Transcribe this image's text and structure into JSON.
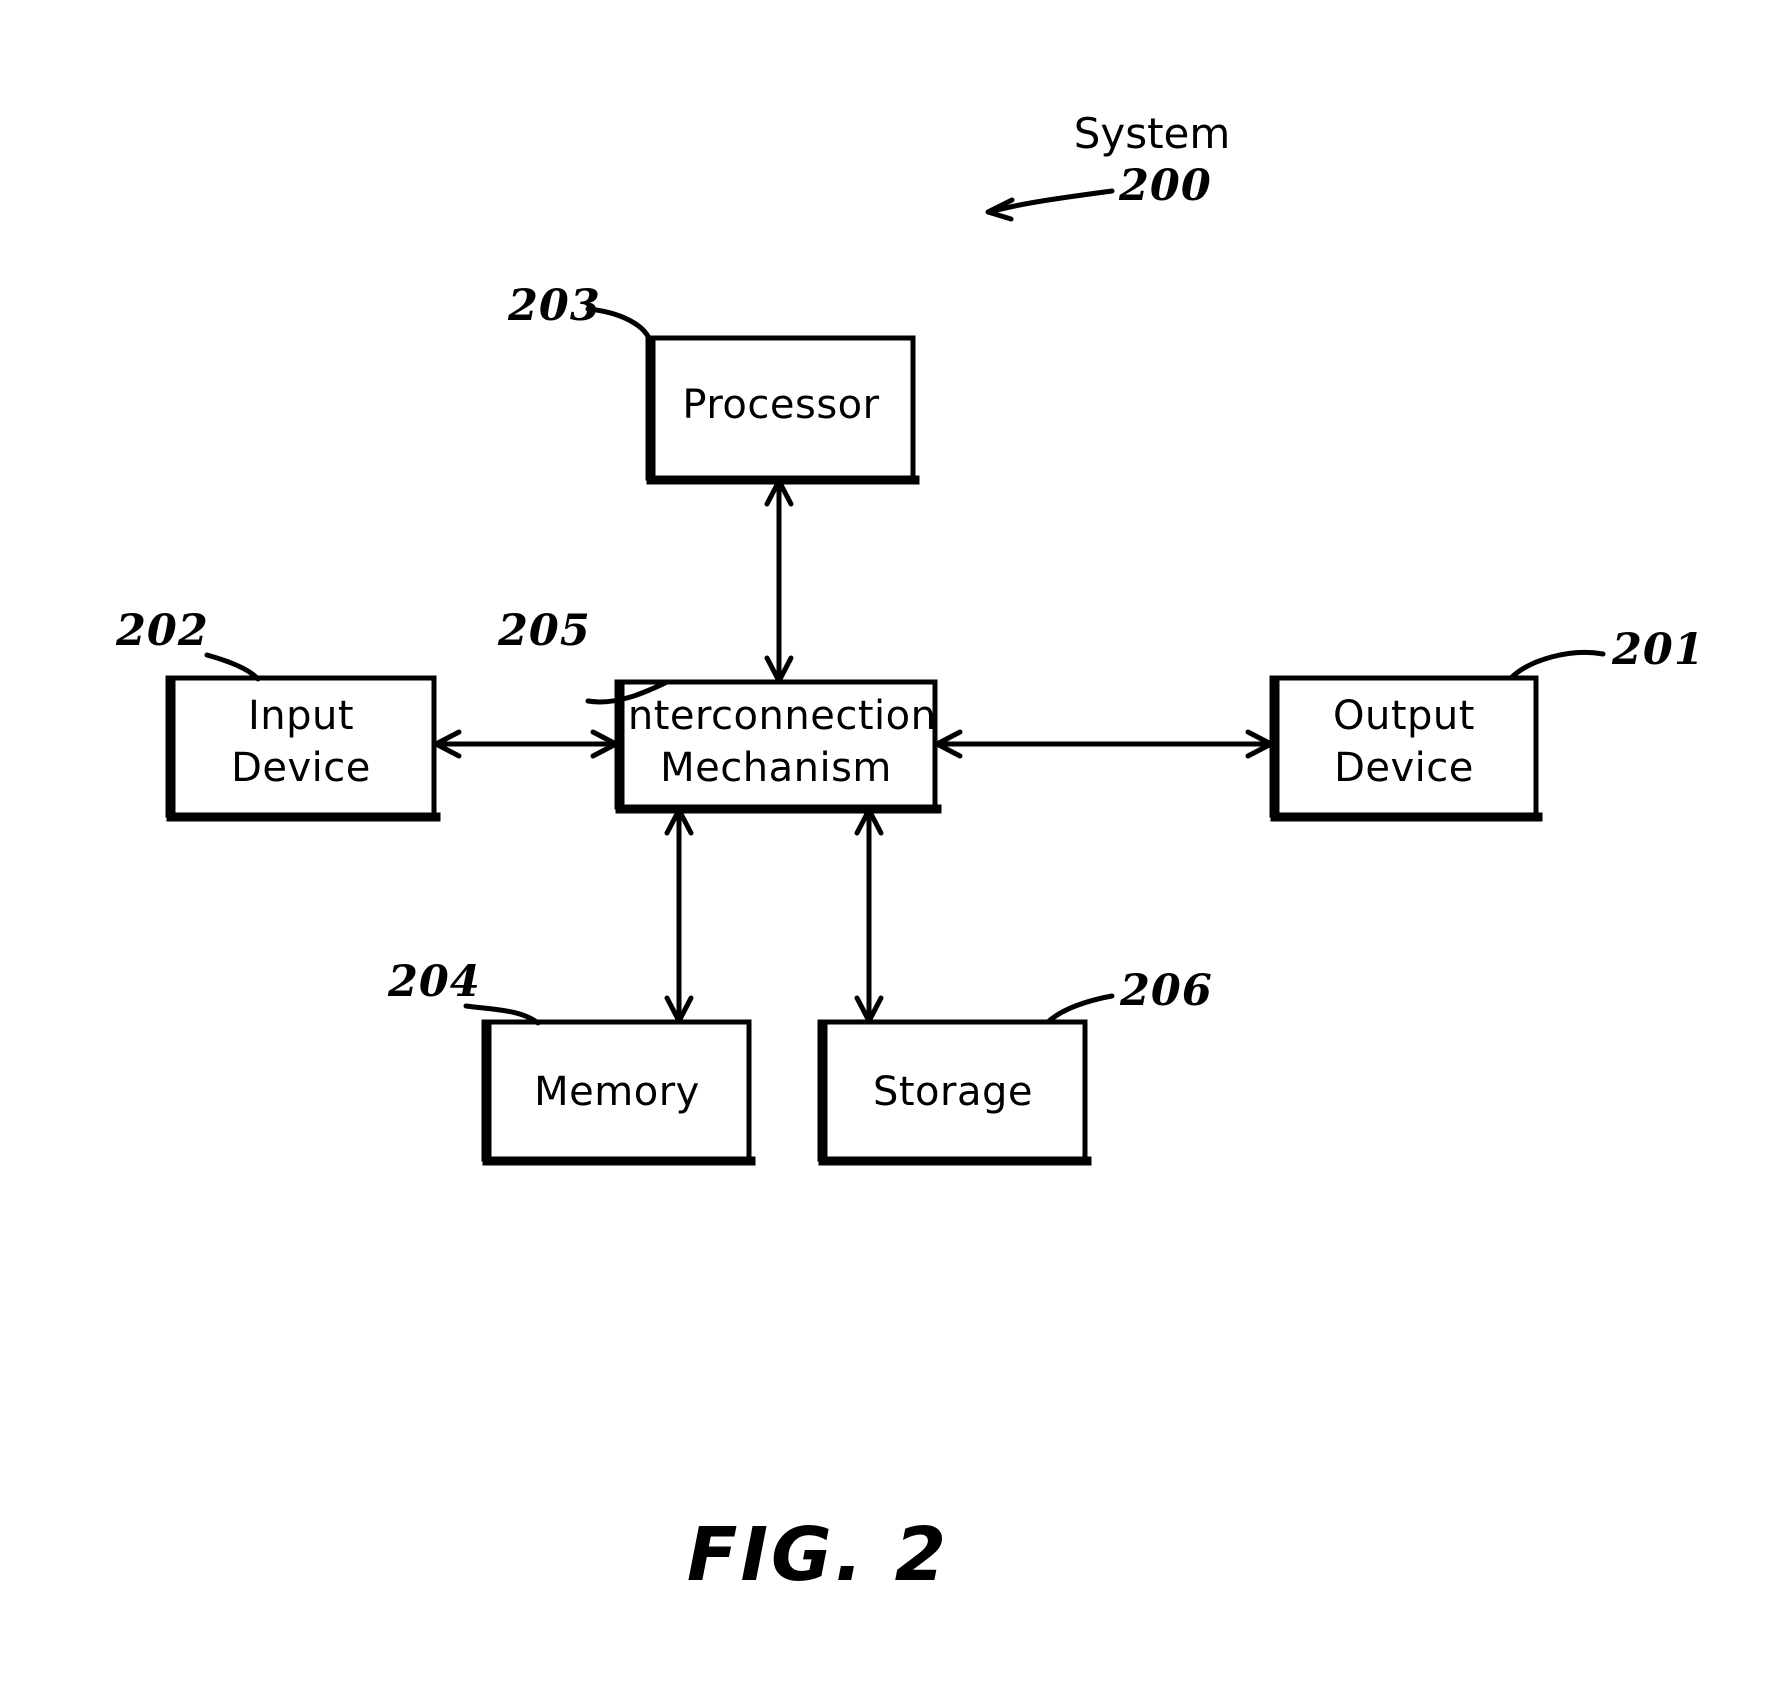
{
  "figure": {
    "caption": "FIG.  2",
    "system_callout": {
      "word": "System",
      "numeral": "200"
    },
    "blocks": [
      {
        "id": "processor",
        "label": "Processor",
        "label_line2": "",
        "numeral": "203"
      },
      {
        "id": "interconnection-mechanism",
        "label": "Interconnection",
        "label_line2": "Mechanism",
        "numeral": "205"
      },
      {
        "id": "input-device",
        "label": "Input",
        "label_line2": "Device",
        "numeral": "202"
      },
      {
        "id": "output-device",
        "label": "Output",
        "label_line2": "Device",
        "numeral": "201"
      },
      {
        "id": "memory",
        "label": "Memory",
        "label_line2": "",
        "numeral": "204"
      },
      {
        "id": "storage",
        "label": "Storage",
        "label_line2": "",
        "numeral": "206"
      }
    ],
    "colors": {
      "ink": "#000000",
      "background": "#ffffff"
    }
  }
}
